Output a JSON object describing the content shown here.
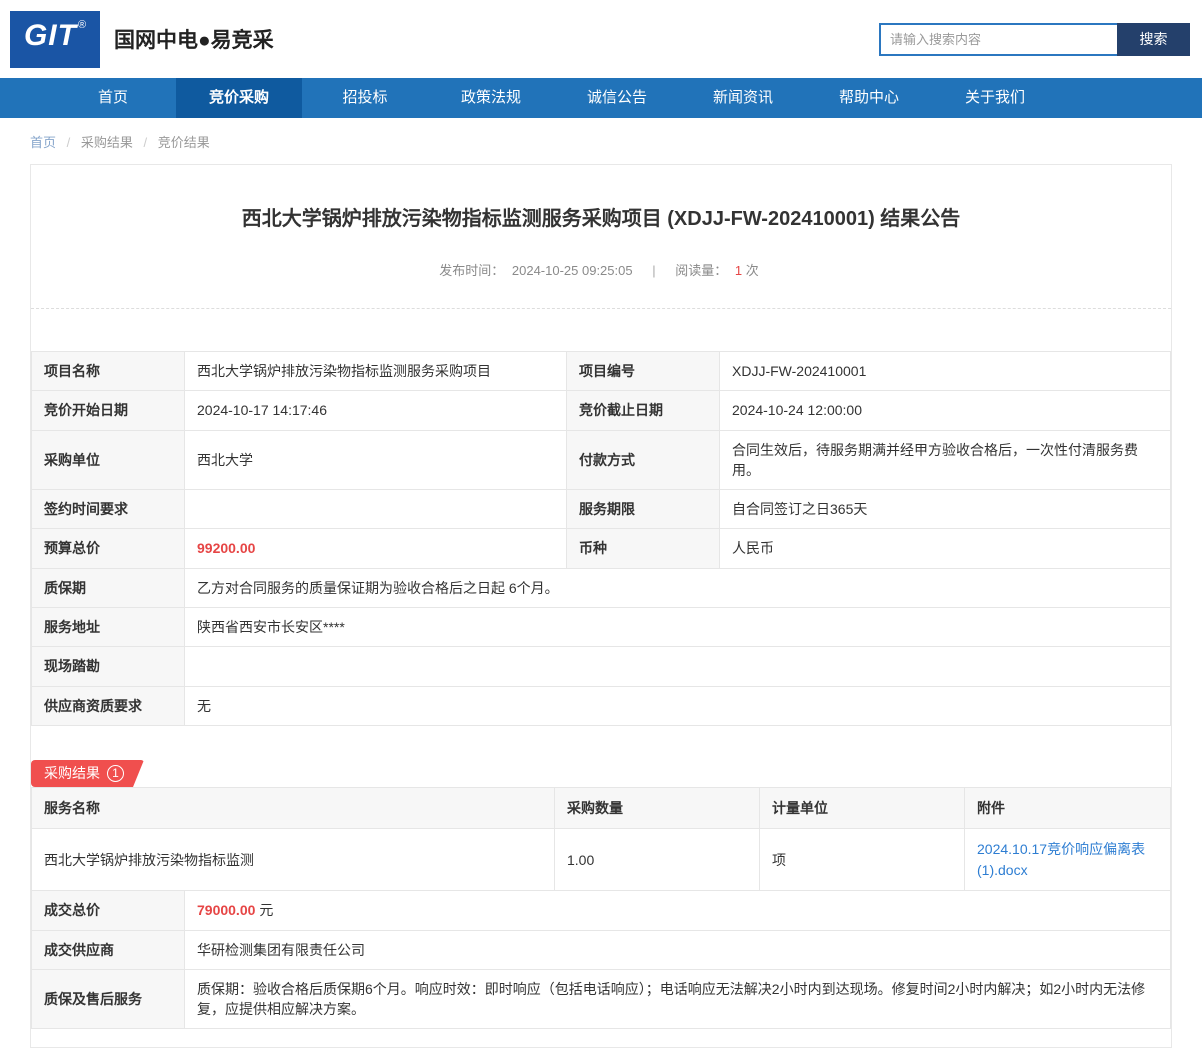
{
  "header": {
    "logo_text": "GIT",
    "logo_reg": "®",
    "site_name": "国网中电●易竞采",
    "search_placeholder": "请输入搜索内容",
    "search_button": "搜索"
  },
  "nav": {
    "items": [
      {
        "label": "首页"
      },
      {
        "label": "竞价采购",
        "active": true
      },
      {
        "label": "招投标"
      },
      {
        "label": "政策法规"
      },
      {
        "label": "诚信公告"
      },
      {
        "label": "新闻资讯"
      },
      {
        "label": "帮助中心"
      },
      {
        "label": "关于我们"
      }
    ]
  },
  "breadcrumb": {
    "items": [
      "首页",
      "采购结果",
      "竞价结果"
    ],
    "separator": "/"
  },
  "article": {
    "title": "西北大学锅炉排放污染物指标监测服务采购项目 (XDJJ-FW-202410001) 结果公告",
    "publish_label": "发布时间：",
    "publish_time": "2024-10-25 09:25:05",
    "separator": "|",
    "read_label": "阅读量：",
    "read_count": "1",
    "read_suffix": "次"
  },
  "details": {
    "row1": {
      "l1": "项目名称",
      "v1": "西北大学锅炉排放污染物指标监测服务采购项目",
      "l2": "项目编号",
      "v2": "XDJJ-FW-202410001"
    },
    "row2": {
      "l1": "竞价开始日期",
      "v1": "2024-10-17 14:17:46",
      "l2": "竞价截止日期",
      "v2": "2024-10-24 12:00:00"
    },
    "row3": {
      "l1": "采购单位",
      "v1": "西北大学",
      "l2": "付款方式",
      "v2": "合同生效后，待服务期满并经甲方验收合格后，一次性付清服务费用。"
    },
    "row4": {
      "l1": "签约时间要求",
      "v1": "",
      "l2": "服务期限",
      "v2": "自合同签订之日365天"
    },
    "row5": {
      "l1": "预算总价",
      "v1": "99200.00",
      "l2": "币种",
      "v2": "人民币"
    },
    "row6": {
      "l": "质保期",
      "v": "乙方对合同服务的质量保证期为验收合格后之日起 6个月。"
    },
    "row7": {
      "l": "服务地址",
      "v": "陕西省西安市长安区****"
    },
    "row8": {
      "l": "现场踏勘",
      "v": ""
    },
    "row9": {
      "l": "供应商资质要求",
      "v": "无"
    }
  },
  "result": {
    "badge_label": "采购结果",
    "badge_count": "1",
    "headers": [
      "服务名称",
      "采购数量",
      "计量单位",
      "附件"
    ],
    "row": {
      "service_name": "西北大学锅炉排放污染物指标监测",
      "quantity": "1.00",
      "unit": "项",
      "attachment": "2024.10.17竞价响应偏离表(1).docx"
    },
    "total_label": "成交总价",
    "total_value": "79000.00",
    "total_unit": "元",
    "supplier_label": "成交供应商",
    "supplier_value": "华研检测集团有限责任公司",
    "warranty_label": "质保及售后服务",
    "warranty_value": "质保期：验收合格后质保期6个月。响应时效：即时响应（包括电话响应）；电话响应无法解决2小时内到达现场。修复时间2小时内解决；如2小时内无法修复，应提供相应解决方案。"
  },
  "colors": {
    "nav_blue": "#2173b9",
    "nav_active_blue": "#0f5a9f",
    "logo_navy": "#1a55a5",
    "search_button_navy": "#24406b",
    "accent_red": "#e64545",
    "badge_red": "#f04f4e",
    "link_blue": "#2d7dd2"
  }
}
